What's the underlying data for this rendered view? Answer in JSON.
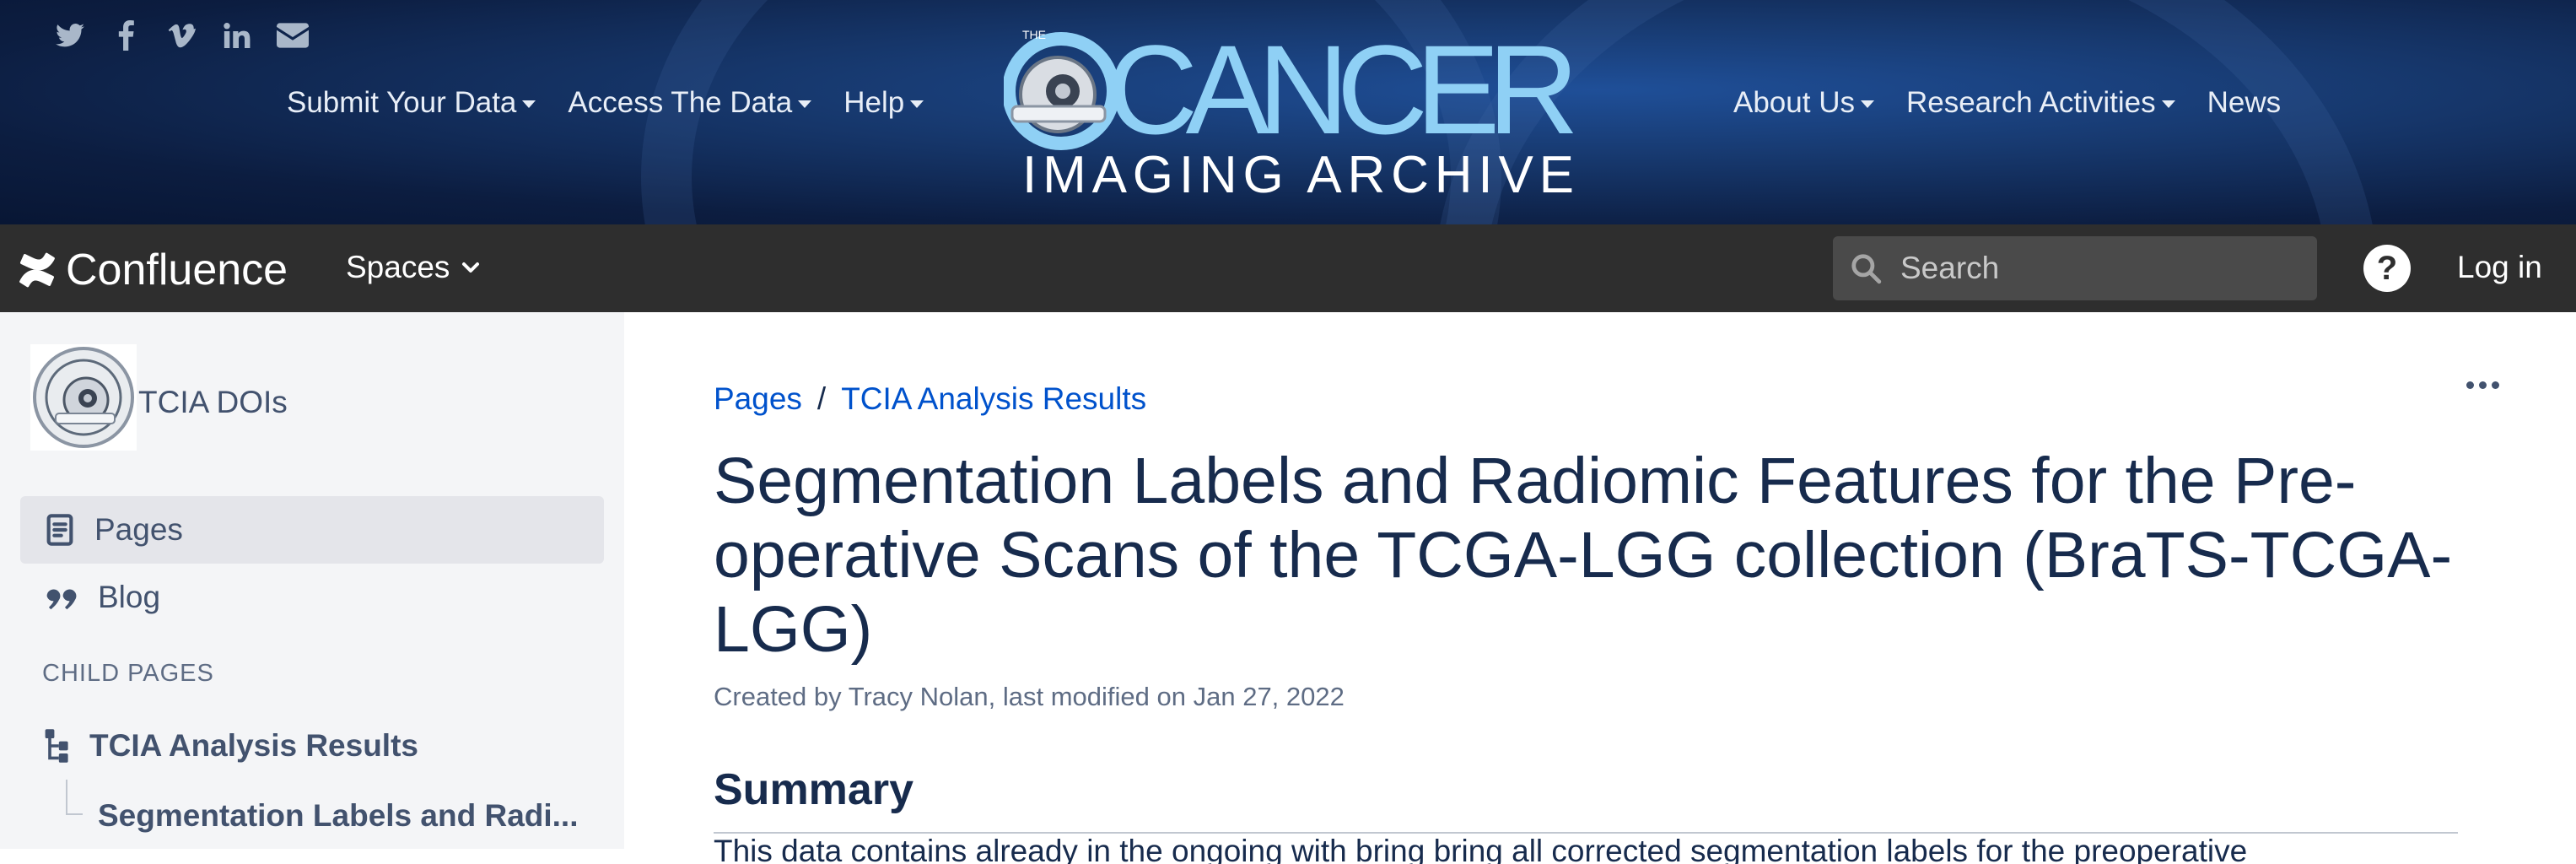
{
  "banner": {
    "social_icons": [
      "twitter-icon",
      "facebook-icon",
      "vimeo-icon",
      "linkedin-icon",
      "email-icon"
    ],
    "nav_left": [
      {
        "label": "Submit Your Data",
        "has_dropdown": true
      },
      {
        "label": "Access The Data",
        "has_dropdown": true
      },
      {
        "label": "Help",
        "has_dropdown": true
      }
    ],
    "nav_right": [
      {
        "label": "About Us",
        "has_dropdown": true
      },
      {
        "label": "Research Activities",
        "has_dropdown": true
      },
      {
        "label": "News",
        "has_dropdown": false
      }
    ],
    "logo": {
      "the": "THE",
      "word1": "CANCER",
      "word2": "IMAGING ARCHIVE"
    },
    "colors": {
      "bg_dark": "#0c1d40",
      "bg_mid": "#1f4f98",
      "logo_text": "#8fd0f5",
      "logo_sub": "#ffffff"
    }
  },
  "topbar": {
    "brand": "Confluence",
    "spaces_label": "Spaces",
    "search_placeholder": "Search",
    "help_icon": "?",
    "login_label": "Log in",
    "colors": {
      "bg": "#2e2e2e"
    }
  },
  "sidebar": {
    "space_name": "TCIA DOIs",
    "items": [
      {
        "label": "Pages",
        "icon": "pages-icon",
        "active": true
      },
      {
        "label": "Blog",
        "icon": "quote-icon",
        "active": false
      }
    ],
    "child_pages_heading": "CHILD PAGES",
    "tree": [
      {
        "label": "TCIA Analysis Results"
      },
      {
        "label": "Segmentation Labels and Radi..."
      }
    ]
  },
  "main": {
    "breadcrumbs": [
      "Pages",
      "TCIA Analysis Results"
    ],
    "breadcrumb_separator": "/",
    "title": "Segmentation Labels and Radiomic Features for the Pre-operative Scans of the TCGA-LGG collection (BraTS-TCGA-LGG)",
    "byline": "Created by Tracy Nolan, last modified on Jan 27, 2022",
    "section_heading": "Summary",
    "paragraph_start": "This data contains already in the ongoing with bring bring all corrected segmentation labels for the preoperative"
  }
}
